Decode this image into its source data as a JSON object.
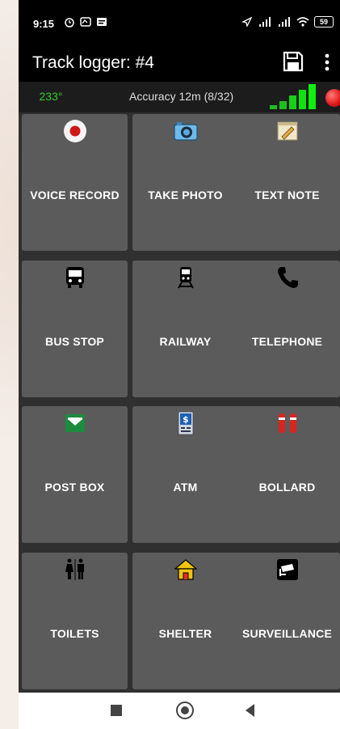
{
  "status": {
    "time": "9:15",
    "battery": "59"
  },
  "appbar": {
    "title": "Track logger: #4",
    "save_icon": "save-icon",
    "menu_icon": "overflow-menu-icon"
  },
  "infobar": {
    "heading": "233°",
    "accuracy": "Accuracy 12m (8/32)",
    "signal_icon": "signal-strength-icon",
    "record_icon": "recording-indicator-icon"
  },
  "tiles": [
    {
      "label": "VOICE RECORD",
      "icon": "record-button-icon"
    },
    {
      "label": "TAKE PHOTO",
      "icon": "camera-icon"
    },
    {
      "label": "TEXT NOTE",
      "icon": "notepad-icon"
    },
    {
      "label": "BUS STOP",
      "icon": "bus-icon"
    },
    {
      "label": "RAILWAY",
      "icon": "train-icon"
    },
    {
      "label": "TELEPHONE",
      "icon": "telephone-icon"
    },
    {
      "label": "POST BOX",
      "icon": "post-box-icon"
    },
    {
      "label": "ATM",
      "icon": "atm-icon"
    },
    {
      "label": "BOLLARD",
      "icon": "bollard-icon"
    },
    {
      "label": "TOILETS",
      "icon": "toilets-icon"
    },
    {
      "label": "SHELTER",
      "icon": "shelter-icon"
    },
    {
      "label": "SURVEILLANCE",
      "icon": "surveillance-camera-icon"
    }
  ],
  "navbar": {
    "recents_icon": "recents-square-icon",
    "home_icon": "home-circle-icon",
    "back_icon": "back-triangle-icon"
  },
  "colors": {
    "heading_green": "#2ccf2c",
    "tile_bg": "#5b5b5b",
    "screen_bg": "#303030"
  }
}
